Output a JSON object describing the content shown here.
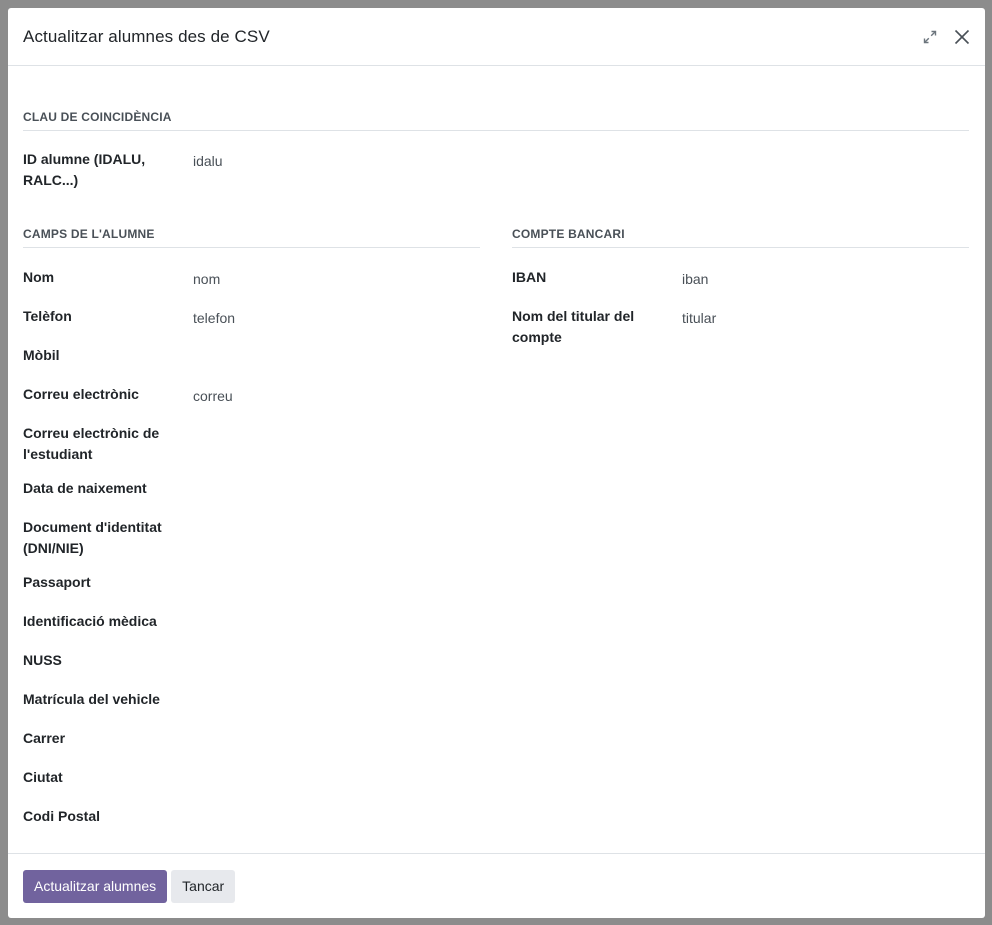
{
  "dialog": {
    "title": "Actualitzar alumnes des de CSV"
  },
  "icons": {
    "expand": "expand-icon",
    "close": "close-icon"
  },
  "match_section": {
    "title": "CLAU DE COINCIDÈNCIA",
    "fields": [
      {
        "label": "ID alumne (IDALU, RALC...)",
        "value": "idalu"
      }
    ]
  },
  "student_section": {
    "title": "CAMPS DE L'ALUMNE",
    "fields": [
      {
        "label": "Nom",
        "value": "nom"
      },
      {
        "label": "Telèfon",
        "value": "telefon"
      },
      {
        "label": "Mòbil",
        "value": ""
      },
      {
        "label": "Correu electrònic",
        "value": "correu"
      },
      {
        "label": "Correu electrònic de l'estudiant",
        "value": ""
      },
      {
        "label": "Data de naixement",
        "value": ""
      },
      {
        "label": "Document d'identitat (DNI/NIE)",
        "value": ""
      },
      {
        "label": "Passaport",
        "value": ""
      },
      {
        "label": "Identificació mèdica",
        "value": ""
      },
      {
        "label": "NUSS",
        "value": ""
      },
      {
        "label": "Matrícula del vehicle",
        "value": ""
      },
      {
        "label": "Carrer",
        "value": ""
      },
      {
        "label": "Ciutat",
        "value": ""
      },
      {
        "label": "Codi Postal",
        "value": ""
      }
    ]
  },
  "bank_section": {
    "title": "COMPTE BANCARI",
    "fields": [
      {
        "label": "IBAN",
        "value": "iban"
      },
      {
        "label": "Nom del titular del compte",
        "value": "titular"
      }
    ]
  },
  "footer": {
    "primary_label": "Actualitzar alumnes",
    "secondary_label": "Tancar"
  },
  "colors": {
    "primary": "#71639e",
    "secondary": "#e7e9ed",
    "backdrop": "#8c8c8c"
  }
}
